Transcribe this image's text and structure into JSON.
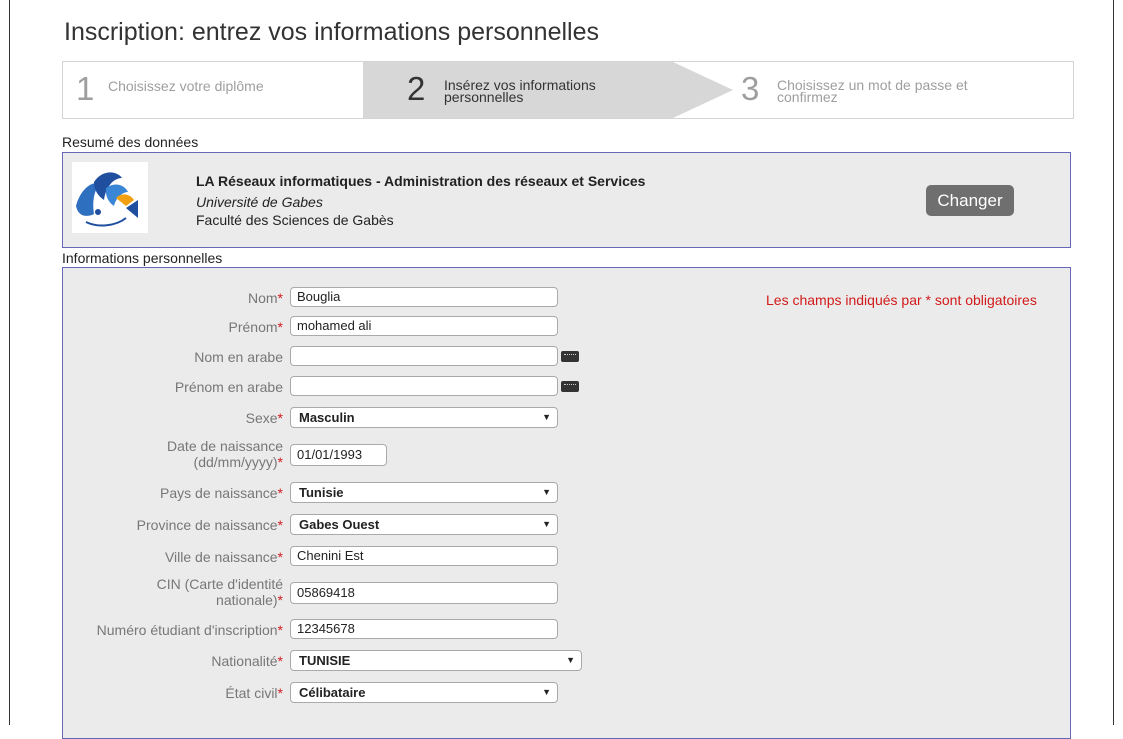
{
  "page": {
    "title": "Inscription: entrez vos informations personnelles"
  },
  "stepper": [
    {
      "num": "1",
      "label_line1": "Choisissez votre diplôme",
      "label_line2": ""
    },
    {
      "num": "2",
      "label_line1": "Insérez vos informations",
      "label_line2": "personnelles"
    },
    {
      "num": "3",
      "label_line1": "Choisissez un mot de passe et",
      "label_line2": "confirmez"
    }
  ],
  "summary": {
    "heading": "Resumé des données",
    "diploma": "LA Réseaux informatiques - Administration des réseaux et Services",
    "university": "Université de Gabes",
    "faculty": "Faculté des Sciences de Gabès",
    "change_label": "Changer"
  },
  "form": {
    "heading": "Informations personnelles",
    "required_note": "Les champs indiqués par * sont obligatoires",
    "required_mark": "*",
    "fields": {
      "nom": {
        "label": "Nom",
        "value": "Bouglia"
      },
      "prenom": {
        "label": "Prénom",
        "value": "mohamed ali"
      },
      "nom_arabe": {
        "label": "Nom en arabe",
        "value": ""
      },
      "prenom_arabe": {
        "label": "Prénom en arabe",
        "value": ""
      },
      "sexe": {
        "label": "Sexe",
        "value": "Masculin"
      },
      "date_naissance": {
        "label_line1": "Date de naissance",
        "label_line2": "(dd/mm/yyyy)",
        "value": "01/01/1993"
      },
      "pays": {
        "label": "Pays de naissance",
        "value": "Tunisie"
      },
      "province": {
        "label": "Province de naissance",
        "value": "Gabes Ouest"
      },
      "ville": {
        "label": "Ville de naissance",
        "value": "Chenini Est"
      },
      "cin": {
        "label_line1": "CIN (Carte d'identité",
        "label_line2": "nationale)",
        "value": "05869418"
      },
      "numero": {
        "label": "Numéro étudiant d'inscription",
        "value": "12345678"
      },
      "nationalite": {
        "label": "Nationalité",
        "value": "TUNISIE"
      },
      "etat_civil": {
        "label": "État civil",
        "value": "Célibataire"
      }
    }
  },
  "icons": {
    "keyboard": "keyboard-icon",
    "caret": "chevron-down-icon"
  },
  "colors": {
    "required": "#d11a1a",
    "box_border": "#6666bb",
    "panel_bg": "#ebebeb",
    "active_step": "#d7d7d7",
    "button_bg": "#6f6f6f"
  }
}
